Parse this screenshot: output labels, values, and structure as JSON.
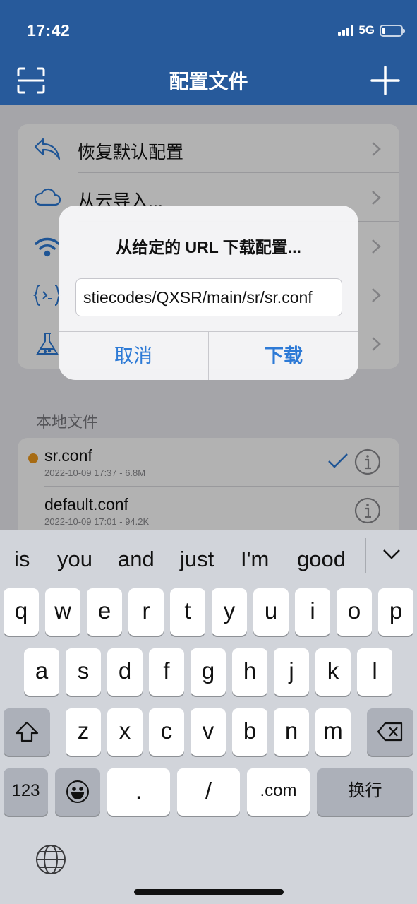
{
  "status_bar": {
    "time": "17:42",
    "network": "5G"
  },
  "nav": {
    "title": "配置文件",
    "left_icon": "scan-icon",
    "right_icon": "plus-icon"
  },
  "menu": {
    "items": [
      {
        "label": "恢复默认配置",
        "icon": "undo-arrow-icon"
      },
      {
        "label": "从云导入...",
        "icon": "cloud-icon"
      },
      {
        "label": "",
        "icon": "wifi-icon"
      },
      {
        "label": "",
        "icon": "code-braces-icon"
      },
      {
        "label": "",
        "icon": "flask-icon"
      }
    ]
  },
  "local_files": {
    "section_title": "本地文件",
    "files": [
      {
        "name": "sr.conf",
        "meta": "2022-10-09 17:37 - 6.8M",
        "active": true
      },
      {
        "name": "default.conf",
        "meta": "2022-10-09 17:01 - 94.2K",
        "active": false
      }
    ]
  },
  "alert": {
    "title": "从给定的 URL 下载配置...",
    "input_value": "stiecodes/QXSR/main/sr/sr.conf",
    "cancel_label": "取消",
    "confirm_label": "下载"
  },
  "keyboard": {
    "suggestions": [
      "is",
      "you",
      "and",
      "just",
      "I'm",
      "good"
    ],
    "row1": [
      "q",
      "w",
      "e",
      "r",
      "t",
      "y",
      "u",
      "i",
      "o",
      "p"
    ],
    "row2": [
      "a",
      "s",
      "d",
      "f",
      "g",
      "h",
      "j",
      "k",
      "l"
    ],
    "row3": [
      "z",
      "x",
      "c",
      "v",
      "b",
      "n",
      "m"
    ],
    "numbers_label": "123",
    "dot_label": ".",
    "slash_label": "/",
    "dotcom_label": ".com",
    "return_label": "换行"
  },
  "colors": {
    "nav_bar": "#275a9b",
    "accent": "#2d7ad6",
    "active_dot": "#f09a1c"
  }
}
